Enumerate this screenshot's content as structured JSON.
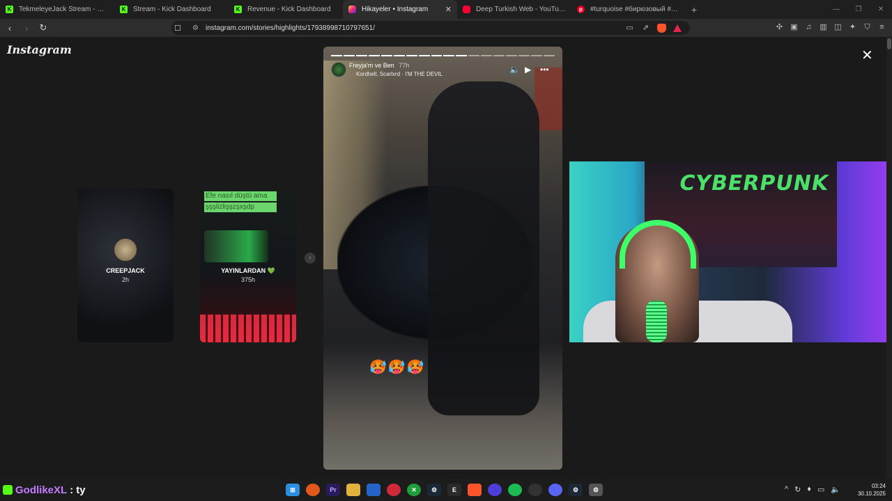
{
  "browser": {
    "tabs": [
      {
        "label": "TekmeleyeJack Stream - Watch Live o",
        "icon": "kick-icon",
        "active": false
      },
      {
        "label": "Stream - Kick Dashboard",
        "icon": "kick-icon",
        "active": false
      },
      {
        "label": "Revenue - Kick Dashboard",
        "icon": "kick-icon",
        "active": false
      },
      {
        "label": "Hikayeler • Instagram",
        "icon": "instagram-icon",
        "active": true
      },
      {
        "label": "Deep Turkish Web - YouTube",
        "icon": "youtube-icon",
        "active": false
      },
      {
        "label": "#turquoise #бирюзовый #aesthetic",
        "icon": "pinterest-icon",
        "active": false
      }
    ],
    "new_tab": "+",
    "url": "instagram.com/stories/highlights/17938998710797651/"
  },
  "instagram": {
    "logo": "Instagram",
    "close": "✕",
    "previews": [
      {
        "name": "CREEPJACK",
        "time": "2h"
      },
      {
        "name": "YAYINLARDAN 💚",
        "time": "375h",
        "caption_line1": "Efe nasıl düştü ama",
        "caption_line2": "şşşlizlişşzşxşdp"
      }
    ],
    "story": {
      "user": "Freyja'm ve Ben",
      "time": "77h",
      "music": "Kordhell, Scarlxrd · I'M THE DEVIL",
      "emojis": "🥵🥵🥵",
      "progress_segments": 18,
      "progress_done": 11
    }
  },
  "webcam": {
    "poster_text": "CYBERPUNK"
  },
  "taskbar": {
    "chat_user": "GodlikeXL",
    "chat_sep": " : ",
    "chat_message": "ty",
    "clock_time": "03:24",
    "clock_date": "30.10.2025"
  }
}
